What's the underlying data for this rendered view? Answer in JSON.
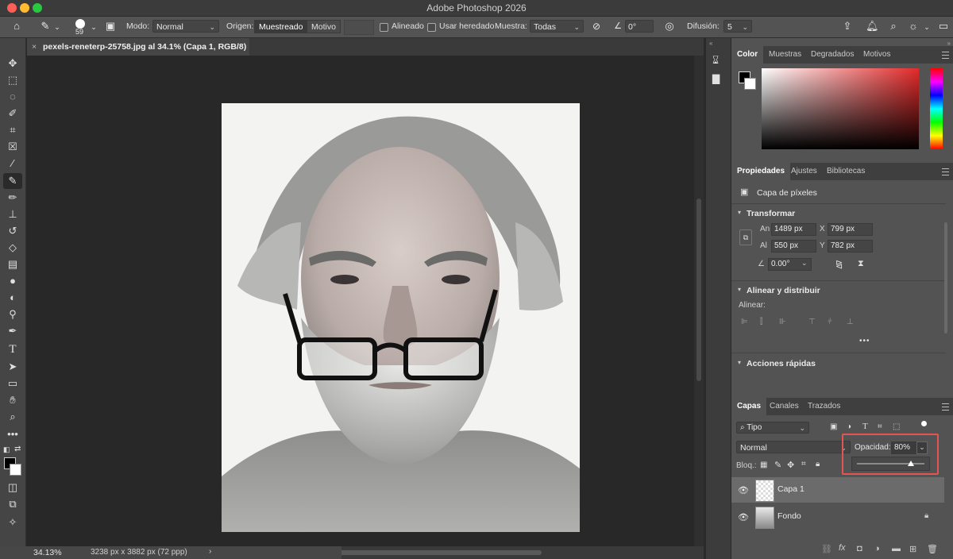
{
  "window": {
    "title": "Adobe Photoshop 2026",
    "lights": [
      "#ff5f57",
      "#febc2e",
      "#28c840"
    ]
  },
  "options": {
    "brush_size": "59",
    "mode_label": "Modo:",
    "mode_value": "Normal",
    "origin_label": "Origen:",
    "origin_sampled": "Muestreado",
    "origin_pattern": "Motivo",
    "aligned_label": "Alineado",
    "use_legacy_label": "Usar heredado",
    "sample_label": "Muestra:",
    "sample_value": "Todas",
    "angle_value": "0°",
    "diffusion_label": "Difusión:",
    "diffusion_value": "5"
  },
  "document": {
    "tab_title": "pexels-reneterp-25758.jpg al 34.1% (Capa 1, RGB/8) *"
  },
  "status": {
    "zoom": "34.13%",
    "dimensions": "3238 px x 3882 px (72 ppp)"
  },
  "panels": {
    "color_tabs": [
      "Color",
      "Muestras",
      "Degradados",
      "Motivos"
    ],
    "props_tabs": [
      "Propiedades",
      "Ajustes",
      "Bibliotecas"
    ],
    "pixel_layer": "Capa de píxeles",
    "transform_title": "Transformar",
    "transform": {
      "w_label": "An",
      "w_value": "1489 px",
      "x_label": "X",
      "x_value": "799 px",
      "h_label": "Al",
      "h_value": "550 px",
      "y_label": "Y",
      "y_value": "782 px",
      "angle_value": "0.00°"
    },
    "align_title": "Alinear y distribuir",
    "align_label": "Alinear:",
    "more": "•••",
    "quick_actions": "Acciones rápidas",
    "layers_tabs": [
      "Capas",
      "Canales",
      "Trazados"
    ],
    "filter_value": "Tipo",
    "blend_mode": "Normal",
    "opacity_label": "Opacidad:",
    "opacity_value": "80%",
    "opacity_fraction": 0.8,
    "lock_label": "Bloq.:",
    "layers": [
      {
        "name": "Capa 1",
        "selected": true
      },
      {
        "name": "Fondo",
        "selected": false
      }
    ]
  }
}
